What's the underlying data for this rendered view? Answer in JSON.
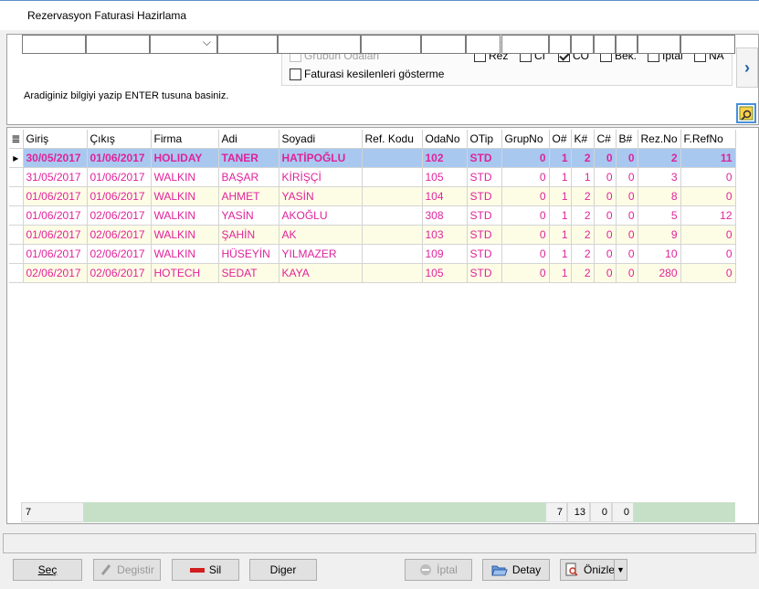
{
  "window": {
    "title": "Rezervasyon Faturasi Hazirlama"
  },
  "filters": {
    "grubun_odalari": "Grubun Odalari",
    "faturasi_kesilen": "Faturasi kesilenleri gösterme",
    "status_checks": [
      {
        "label": "Rez",
        "checked": false
      },
      {
        "label": "CI",
        "checked": false
      },
      {
        "label": "CO",
        "checked": true
      },
      {
        "label": "Bek.",
        "checked": false
      },
      {
        "label": "İptal",
        "checked": false
      },
      {
        "label": "NA",
        "checked": false
      }
    ],
    "hint": "Aradiginiz bilgiyi yazip ENTER tusuna basiniz."
  },
  "grid": {
    "columns": [
      "Giriş",
      "Çıkış",
      "Firma",
      "Adi",
      "Soyadi",
      "Ref. Kodu",
      "OdaNo",
      "OTip",
      "GrupNo",
      "O#",
      "K#",
      "C#",
      "B#",
      "Rez.No",
      "F.RefNo"
    ],
    "rows": [
      [
        "30/05/2017",
        "01/06/2017",
        "HOLIDAY",
        "TANER",
        "HATİPOĞLU",
        "",
        "102",
        "STD",
        "0",
        "1",
        "2",
        "0",
        "0",
        "2",
        "11"
      ],
      [
        "31/05/2017",
        "01/06/2017",
        "WALKIN",
        "BAŞAR",
        "KİRİŞÇİ",
        "",
        "105",
        "STD",
        "0",
        "1",
        "1",
        "0",
        "0",
        "3",
        "0"
      ],
      [
        "01/06/2017",
        "01/06/2017",
        "WALKIN",
        "AHMET",
        "YASİN",
        "",
        "104",
        "STD",
        "0",
        "1",
        "2",
        "0",
        "0",
        "8",
        "0"
      ],
      [
        "01/06/2017",
        "02/06/2017",
        "WALKIN",
        "YASİN",
        "AKOĞLU",
        "",
        "308",
        "STD",
        "0",
        "1",
        "2",
        "0",
        "0",
        "5",
        "12"
      ],
      [
        "01/06/2017",
        "02/06/2017",
        "WALKIN",
        "ŞAHİN",
        "AK",
        "",
        "103",
        "STD",
        "0",
        "1",
        "2",
        "0",
        "0",
        "9",
        "0"
      ],
      [
        "01/06/2017",
        "02/06/2017",
        "WALKIN",
        "HÜSEYİN",
        "YILMAZER",
        "",
        "109",
        "STD",
        "0",
        "1",
        "2",
        "0",
        "0",
        "10",
        "0"
      ],
      [
        "02/06/2017",
        "02/06/2017",
        "HOTECH",
        "SEDAT",
        "KAYA",
        "",
        "105",
        "STD",
        "0",
        "1",
        "2",
        "0",
        "0",
        "280",
        "0"
      ]
    ],
    "footer": {
      "count": "7",
      "o_total": "7",
      "k_total": "13",
      "c_total": "0",
      "b_total": "0"
    }
  },
  "buttons": {
    "sec": "Seç",
    "degistir": "Degistir",
    "sil": "Sil",
    "diger": "Diger",
    "iptal": "İptal",
    "detay": "Detay",
    "onizle": "Önizle"
  },
  "colors": {
    "row_text": "#e0229b",
    "selected_row": "#a8c8f0",
    "footer_green": "#c6e0c8"
  }
}
